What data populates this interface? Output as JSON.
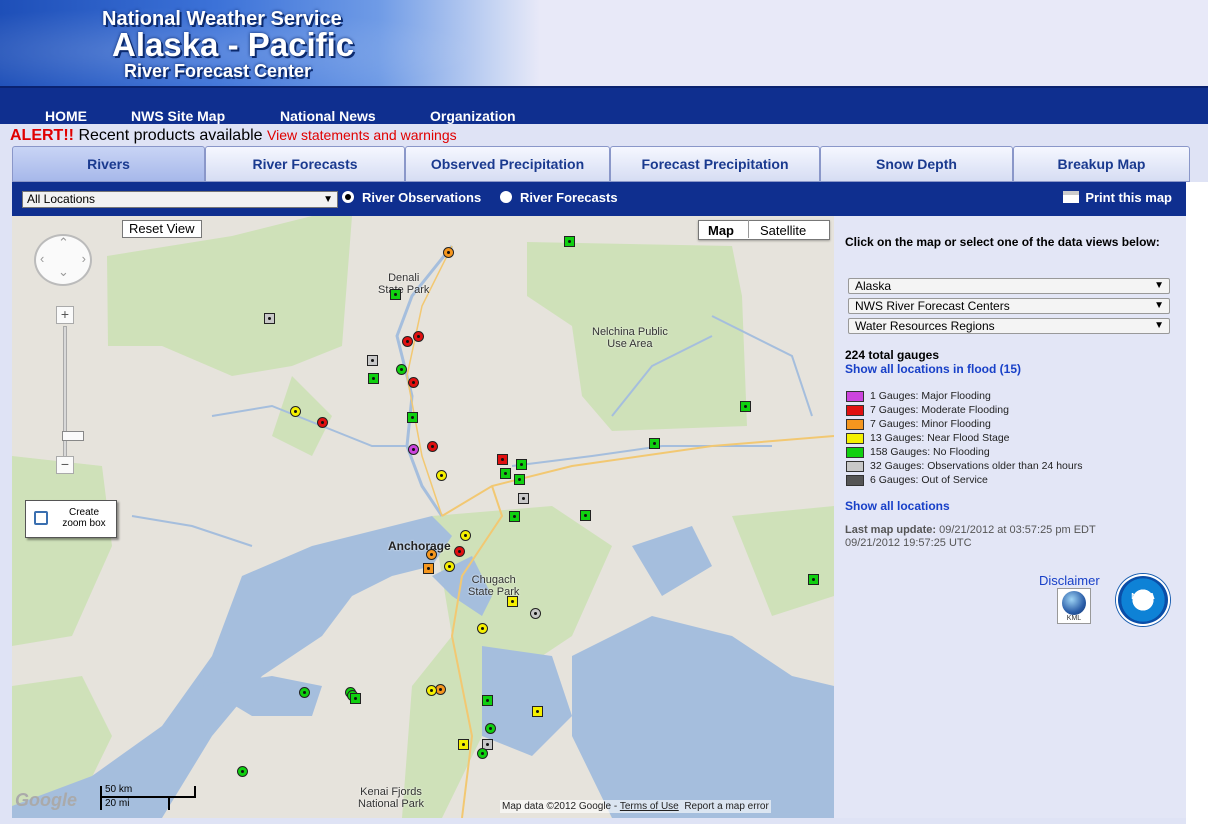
{
  "banner": {
    "line1": "National Weather Service",
    "line2": "Alaska - Pacific",
    "line3": "River Forecast Center"
  },
  "nav": [
    "HOME",
    "NWS Site Map",
    "National News",
    "Organization"
  ],
  "alert": {
    "prefix": "ALERT!!",
    "text": "Recent products available",
    "link": "View statements and warnings"
  },
  "tabs": [
    "Rivers",
    "River Forecasts",
    "Observed Precipitation",
    "Forecast Precipitation",
    "Snow Depth",
    "Breakup Map"
  ],
  "active_tab": "Rivers",
  "toolbar": {
    "location_select": "All Locations",
    "radio_observations": "River Observations",
    "radio_forecasts": "River Forecasts",
    "selected_radio": "River Observations",
    "print": "Print this map"
  },
  "map": {
    "reset": "Reset View",
    "type_map": "Map",
    "type_satellite": "Satellite",
    "zoom_box": "Create zoom box",
    "labels": {
      "denali": "Denali\nState Park",
      "nelchina": "Nelchina Public\nUse Area",
      "anchorage": "Anchorage",
      "chugach": "Chugach\nState Park",
      "kenai": "Kenai Fjords\nNational Park"
    },
    "scale_km": "50 km",
    "scale_mi": "20 mi",
    "google": "Google",
    "attribution": "Map data ©2012 Google -",
    "terms": "Terms of Use",
    "report": "Report a map error"
  },
  "side": {
    "prompt": "Click on the map or select one of the data views below:",
    "selects": [
      "Alaska",
      "NWS River Forecast Centers",
      "Water Resources Regions"
    ],
    "total": "224 total gauges",
    "flood_link": "Show all locations in flood (15)",
    "legend": [
      {
        "label": "1 Gauges: Major Flooding",
        "color": "#cc44dd"
      },
      {
        "label": "7 Gauges: Moderate Flooding",
        "color": "#e01010"
      },
      {
        "label": "7 Gauges: Minor Flooding",
        "color": "#f5961e"
      },
      {
        "label": "13 Gauges: Near Flood Stage",
        "color": "#f5f000"
      },
      {
        "label": "158 Gauges: No Flooding",
        "color": "#10d010"
      },
      {
        "label": "32 Gauges: Observations older than 24 hours",
        "color": "#c8c8c8"
      },
      {
        "label": "6 Gauges: Out of Service",
        "color": "#555555"
      }
    ],
    "all_link": "Show all locations",
    "update_label": "Last map update:",
    "update_local": "09/21/2012 at 03:57:25 pm EDT",
    "update_utc": "09/21/2012 19:57:25 UTC",
    "disclaimer": "Disclaimer",
    "kml": "KML",
    "noaa": "NOAA"
  },
  "colors": {
    "major": "#cc44dd",
    "moderate": "#e01010",
    "minor": "#f5961e",
    "near": "#f5f000",
    "none": "#10d010",
    "old": "#c8c8c8",
    "oos": "#555555"
  },
  "gauges": [
    {
      "s": "sq",
      "c": "none"
    },
    {
      "s": "c",
      "c": "minor"
    },
    {
      "s": "sq",
      "c": "none"
    },
    {
      "s": "sq",
      "c": "old"
    },
    {
      "s": "c",
      "c": "moderate"
    },
    {
      "s": "c",
      "c": "moderate"
    },
    {
      "s": "sq",
      "c": "old"
    },
    {
      "s": "c",
      "c": "none"
    },
    {
      "s": "sq",
      "c": "none"
    },
    {
      "s": "c",
      "c": "moderate"
    },
    {
      "s": "c",
      "c": "near"
    },
    {
      "s": "c",
      "c": "moderate"
    },
    {
      "s": "sq",
      "c": "none"
    },
    {
      "s": "c",
      "c": "major"
    },
    {
      "s": "c",
      "c": "moderate"
    },
    {
      "s": "sq",
      "c": "none"
    },
    {
      "s": "sq",
      "c": "none"
    },
    {
      "s": "sq",
      "c": "moderate"
    },
    {
      "s": "sq",
      "c": "none"
    },
    {
      "s": "sq",
      "c": "none"
    },
    {
      "s": "sq",
      "c": "none"
    },
    {
      "s": "c",
      "c": "near"
    },
    {
      "s": "sq",
      "c": "old"
    },
    {
      "s": "sq",
      "c": "none"
    },
    {
      "s": "sq",
      "c": "none"
    },
    {
      "s": "c",
      "c": "near"
    },
    {
      "s": "c",
      "c": "moderate"
    },
    {
      "s": "c",
      "c": "minor"
    },
    {
      "s": "sq",
      "c": "minor"
    },
    {
      "s": "c",
      "c": "near"
    },
    {
      "s": "sq",
      "c": "near"
    },
    {
      "s": "c",
      "c": "old"
    },
    {
      "s": "c",
      "c": "near"
    },
    {
      "s": "sq",
      "c": "none"
    },
    {
      "s": "c",
      "c": "none"
    },
    {
      "s": "c",
      "c": "none"
    },
    {
      "s": "c",
      "c": "none"
    },
    {
      "s": "sq",
      "c": "none"
    },
    {
      "s": "c",
      "c": "minor"
    },
    {
      "s": "c",
      "c": "near"
    },
    {
      "s": "sq",
      "c": "none"
    },
    {
      "s": "c",
      "c": "none"
    },
    {
      "s": "sq",
      "c": "near"
    },
    {
      "s": "sq",
      "c": "near"
    },
    {
      "s": "sq",
      "c": "old"
    },
    {
      "s": "c",
      "c": "none"
    },
    {
      "s": "c",
      "c": "none"
    }
  ]
}
